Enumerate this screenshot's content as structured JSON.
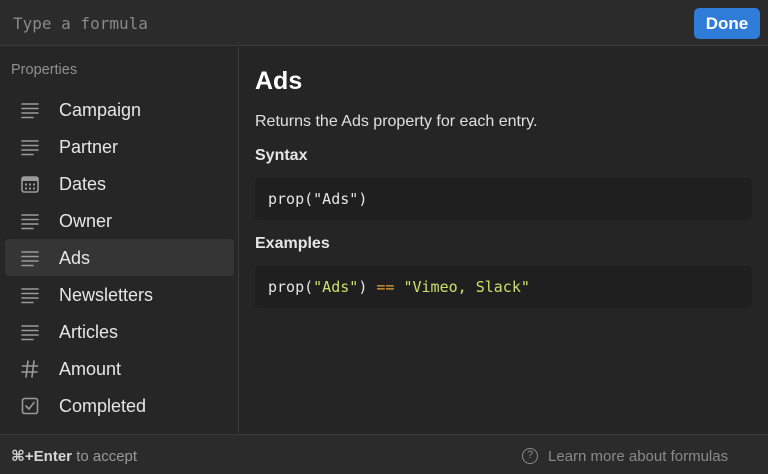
{
  "formula_bar": {
    "placeholder": "Type a formula",
    "value": "",
    "done_label": "Done"
  },
  "sidebar": {
    "title": "Properties",
    "items": [
      {
        "label": "Campaign",
        "icon": "text-lines-icon"
      },
      {
        "label": "Partner",
        "icon": "text-lines-icon"
      },
      {
        "label": "Dates",
        "icon": "calendar-icon"
      },
      {
        "label": "Owner",
        "icon": "text-lines-icon"
      },
      {
        "label": "Ads",
        "icon": "text-lines-icon",
        "active": true
      },
      {
        "label": "Newsletters",
        "icon": "text-lines-icon"
      },
      {
        "label": "Articles",
        "icon": "text-lines-icon"
      },
      {
        "label": "Amount",
        "icon": "hash-icon"
      },
      {
        "label": "Completed",
        "icon": "checkbox-icon"
      }
    ]
  },
  "detail": {
    "title": "Ads",
    "description": "Returns the Ads property for each entry.",
    "syntax_heading": "Syntax",
    "syntax_fn": "prop(",
    "syntax_arg": "\"Ads\"",
    "syntax_close": ")",
    "examples_heading": "Examples",
    "example_fn": "prop(",
    "example_arg": "\"Ads\"",
    "example_close": ") ",
    "example_op": "==",
    "example_space": " ",
    "example_value": "\"Vimeo, Slack\""
  },
  "footer": {
    "shortcut": "⌘+Enter",
    "shortcut_suffix": " to accept",
    "learn_more": "Learn more about formulas",
    "help_symbol": "?"
  },
  "colors": {
    "accent": "#2f7bd8",
    "string": "#cde06c",
    "operator": "#e9a23b"
  }
}
